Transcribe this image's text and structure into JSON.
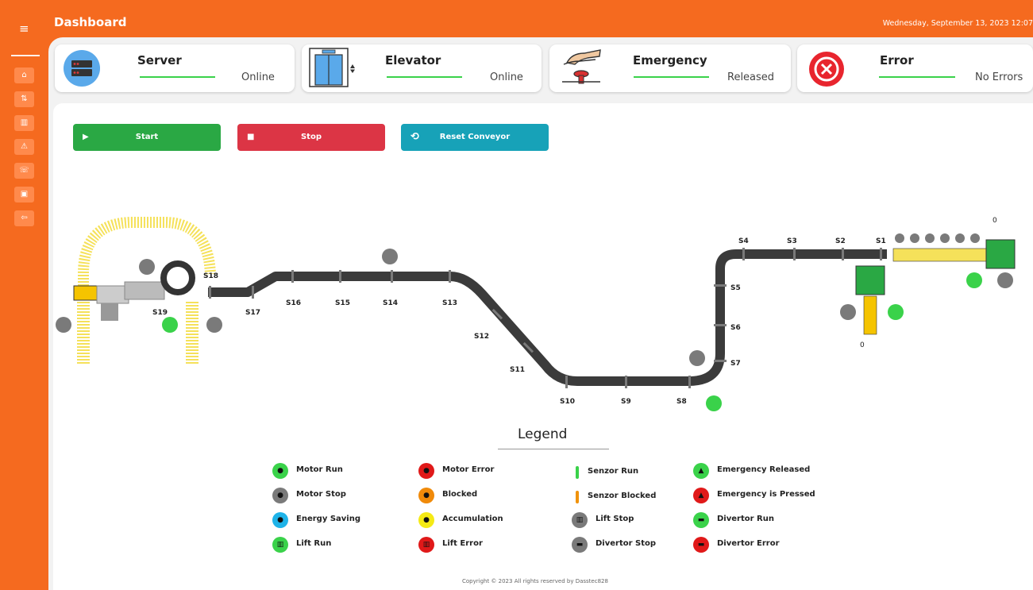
{
  "topbar": {
    "title": "Dashboard",
    "date": "Wednesday, September 13, 2023 12:07"
  },
  "sidebar": {
    "menu_icon": "≡",
    "items": [
      {
        "name": "home",
        "glyph": "⌂"
      },
      {
        "name": "transfer",
        "glyph": "⇅"
      },
      {
        "name": "chart",
        "glyph": "▥"
      },
      {
        "name": "warning",
        "glyph": "⚠"
      },
      {
        "name": "phone",
        "glyph": "☏"
      },
      {
        "name": "save",
        "glyph": "▣"
      },
      {
        "name": "logout",
        "glyph": "⇦"
      }
    ]
  },
  "status": {
    "server": {
      "name": "Server",
      "state": "Online"
    },
    "elevator": {
      "name": "Elevator",
      "state": "Online"
    },
    "emergency": {
      "name": "Emergency",
      "state": "Released"
    },
    "error": {
      "name": "Error",
      "state": "No Errors"
    }
  },
  "actions": {
    "start": "Start",
    "stop": "Stop",
    "reset": "Reset Conveyor"
  },
  "conveyor": {
    "sensors": [
      "S1",
      "S2",
      "S3",
      "S4",
      "S5",
      "S6",
      "S7",
      "S8",
      "S9",
      "S10",
      "S11",
      "S12",
      "S13",
      "S14",
      "S15",
      "S16",
      "S17",
      "S18",
      "S19"
    ],
    "counter_top": "0",
    "counter_bottom": "0"
  },
  "legend": {
    "title": "Legend",
    "items": [
      {
        "label": "Motor Run",
        "color": "#3ad24a",
        "kind": "dot"
      },
      {
        "label": "Motor Stop",
        "color": "#7a7a7a",
        "kind": "dot"
      },
      {
        "label": "Energy Saving",
        "color": "#1fb3e8",
        "kind": "dot"
      },
      {
        "label": "Lift Run",
        "color": "#3ad24a",
        "kind": "dot"
      },
      {
        "label": "Motor Error",
        "color": "#e01919",
        "kind": "dot"
      },
      {
        "label": "Blocked",
        "color": "#f08a0a",
        "kind": "dot"
      },
      {
        "label": "Accumulation",
        "color": "#f5ea15",
        "kind": "dot"
      },
      {
        "label": "Lift Error",
        "color": "#e01919",
        "kind": "dot"
      },
      {
        "label": "Senzor Run",
        "color": "#3ad24a",
        "kind": "pill"
      },
      {
        "label": "Senzor Blocked",
        "color": "#f0920a",
        "kind": "pill"
      },
      {
        "label": "Lift Stop",
        "color": "#7a7a7a",
        "kind": "dot"
      },
      {
        "label": "Divertor Stop",
        "color": "#7a7a7a",
        "kind": "dot"
      },
      {
        "label": "Emergency Released",
        "color": "#3ad24a",
        "kind": "dot"
      },
      {
        "label": "Emergency is Pressed",
        "color": "#e01919",
        "kind": "dot"
      },
      {
        "label": "Divertor Run",
        "color": "#3ad24a",
        "kind": "dot"
      },
      {
        "label": "Divertor Error",
        "color": "#e01919",
        "kind": "dot"
      }
    ]
  },
  "footer": {
    "copyright": "Copyright © 2023 All rights reserved by Dasstec828"
  },
  "colors": {
    "accent": "#f56a1f",
    "start": "#2aa844",
    "stop": "#dc3545",
    "reset": "#17a2b8",
    "belt": "#3b3b3b",
    "roller": "#f5e15a"
  }
}
